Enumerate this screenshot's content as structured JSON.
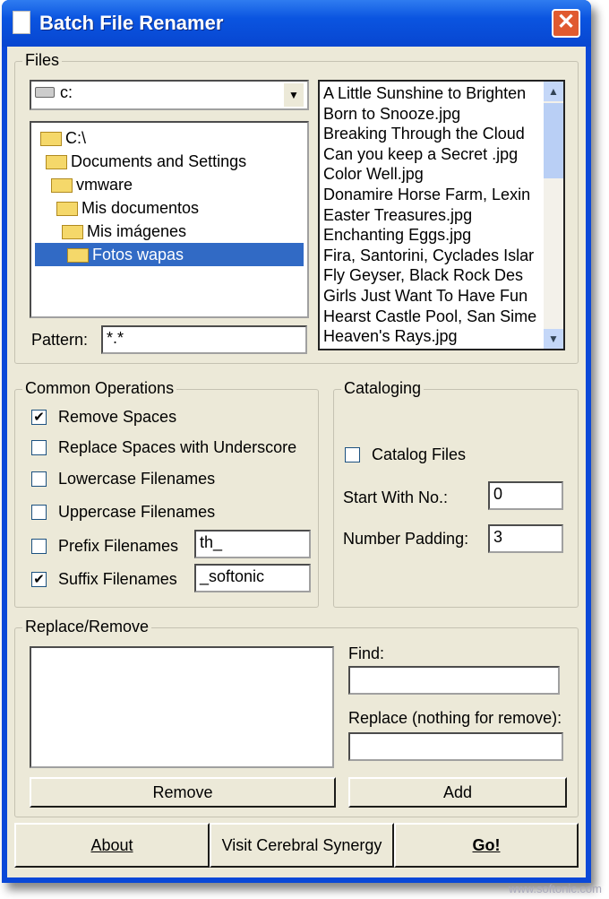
{
  "window": {
    "title": "Batch File Renamer",
    "close": "✕"
  },
  "files": {
    "label": "Files",
    "drive": "c:",
    "tree": [
      "C:\\",
      "Documents and Settings",
      "vmware",
      "Mis documentos",
      "Mis imágenes",
      "Fotos wapas"
    ],
    "selected_index": 5,
    "pattern_label": "Pattern:",
    "pattern": "*.*",
    "list": [
      "A Little Sunshine to Brighten",
      "Born to Snooze.jpg",
      "Breaking Through the Cloud",
      "Can you keep a Secret .jpg",
      "Color Well.jpg",
      "Donamire Horse Farm, Lexin",
      "Easter Treasures.jpg",
      "Enchanting Eggs.jpg",
      "Fira, Santorini, Cyclades Islar",
      "Fly Geyser, Black Rock Des",
      "Girls Just Want To Have Fun",
      "Hearst Castle Pool, San Sime",
      "Heaven's Rays.jpg"
    ]
  },
  "common": {
    "label": "Common Operations",
    "remove_spaces": "Remove Spaces",
    "replace_underscore": "Replace Spaces with Underscore",
    "lowercase": "Lowercase Filenames",
    "uppercase": "Uppercase Filenames",
    "prefix": "Prefix Filenames",
    "prefix_value": "th_",
    "suffix": "Suffix Filenames",
    "suffix_value": "_softonic",
    "checked": {
      "remove_spaces": true,
      "replace_underscore": false,
      "lowercase": false,
      "uppercase": false,
      "prefix": false,
      "suffix": true
    }
  },
  "cataloging": {
    "label": "Cataloging",
    "catalog_files": "Catalog Files",
    "start_label": "Start With No.:",
    "start_value": "0",
    "padding_label": "Number Padding:",
    "padding_value": "3"
  },
  "replace": {
    "label": "Replace/Remove",
    "find_label": "Find:",
    "find_value": "",
    "replace_label": "Replace (nothing for remove):",
    "replace_value": "",
    "remove": "Remove",
    "add": "Add"
  },
  "buttons": {
    "about": "About",
    "visit": "Visit Cerebral Synergy",
    "go": "Go!"
  },
  "watermark": "www.softonic.com"
}
